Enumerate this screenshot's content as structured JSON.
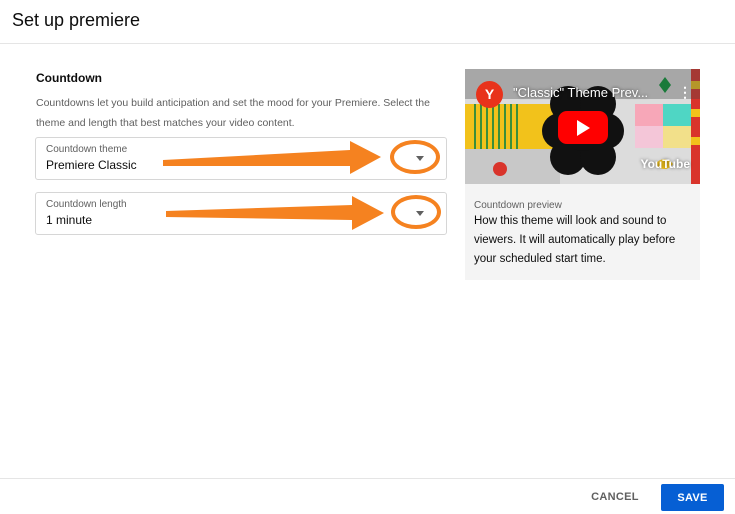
{
  "dialog": {
    "title": "Set up premiere"
  },
  "countdown": {
    "section_title": "Countdown",
    "description": "Countdowns let you build anticipation and set the mood for your Premiere. Select the theme and length that best matches your video content.",
    "theme_select": {
      "label": "Countdown theme",
      "value": "Premiere Classic"
    },
    "length_select": {
      "label": "Countdown length",
      "value": "1 minute"
    }
  },
  "preview": {
    "video_title": "\"Classic\" Theme Prev...",
    "channel_initial": "Y",
    "watermark": "YouTube",
    "caption_label": "Countdown preview",
    "caption_text": "How this theme will look and sound to viewers. It will automatically play before your scheduled start time."
  },
  "footer": {
    "cancel_label": "CANCEL",
    "save_label": "SAVE"
  },
  "colors": {
    "accent_blue": "#065fd4",
    "annotation_orange": "#f58220",
    "play_red": "#ff0000"
  }
}
